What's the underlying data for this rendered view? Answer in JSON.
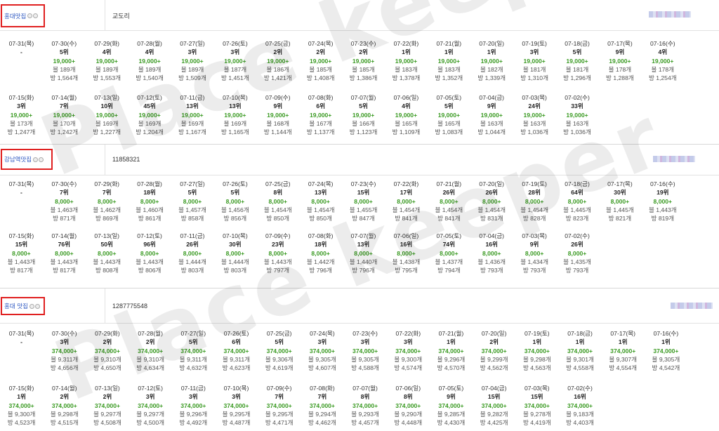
{
  "sections": [
    {
      "keyword": "홍대맛집",
      "code": "교도리",
      "row1": [
        {
          "d": "07-31(목)",
          "r": "-",
          "v": "",
          "a": "",
          "b": ""
        },
        {
          "d": "07-30(수)",
          "r": "5위",
          "v": "19,000+",
          "a": "블 189개",
          "b": "방 1,564개"
        },
        {
          "d": "07-29(화)",
          "r": "4위",
          "v": "19,000+",
          "a": "블 189개",
          "b": "방 1,553개"
        },
        {
          "d": "07-28(월)",
          "r": "4위",
          "v": "19,000+",
          "a": "블 189개",
          "b": "방 1,540개"
        },
        {
          "d": "07-27(일)",
          "r": "3위",
          "v": "19,000+",
          "a": "블 189개",
          "b": "방 1,509개"
        },
        {
          "d": "07-26(토)",
          "r": "3위",
          "v": "19,000+",
          "a": "블 187개",
          "b": "방 1,451개"
        },
        {
          "d": "07-25(금)",
          "r": "2위",
          "v": "19,000+",
          "a": "블 186개",
          "b": "방 1,421개"
        },
        {
          "d": "07-24(목)",
          "r": "2위",
          "v": "19,000+",
          "a": "블 185개",
          "b": "방 1,408개"
        },
        {
          "d": "07-23(수)",
          "r": "2위",
          "v": "19,000+",
          "a": "블 185개",
          "b": "방 1,386개"
        },
        {
          "d": "07-22(화)",
          "r": "1위",
          "v": "19,000+",
          "a": "블 183개",
          "b": "방 1,378개"
        },
        {
          "d": "07-21(월)",
          "r": "1위",
          "v": "19,000+",
          "a": "블 183개",
          "b": "방 1,352개"
        },
        {
          "d": "07-20(일)",
          "r": "1위",
          "v": "19,000+",
          "a": "블 182개",
          "b": "방 1,339개"
        },
        {
          "d": "07-19(토)",
          "r": "3위",
          "v": "19,000+",
          "a": "블 181개",
          "b": "방 1,310개"
        },
        {
          "d": "07-18(금)",
          "r": "5위",
          "v": "19,000+",
          "a": "블 181개",
          "b": "방 1,296개"
        },
        {
          "d": "07-17(목)",
          "r": "9위",
          "v": "19,000+",
          "a": "블 178개",
          "b": "방 1,288개"
        },
        {
          "d": "07-16(수)",
          "r": "4위",
          "v": "19,000+",
          "a": "블 178개",
          "b": "방 1,254개"
        }
      ],
      "row2": [
        {
          "d": "07-15(화)",
          "r": "3위",
          "v": "19,000+",
          "a": "블 173개",
          "b": "방 1,247개"
        },
        {
          "d": "07-14(월)",
          "r": "7위",
          "v": "19,000+",
          "a": "블 170개",
          "b": "방 1,242개"
        },
        {
          "d": "07-13(일)",
          "r": "10위",
          "v": "19,000+",
          "a": "블 169개",
          "b": "방 1,227개"
        },
        {
          "d": "07-12(토)",
          "r": "45위",
          "v": "19,000+",
          "a": "블 169개",
          "b": "방 1,204개"
        },
        {
          "d": "07-11(금)",
          "r": "13위",
          "v": "19,000+",
          "a": "블 169개",
          "b": "방 1,167개"
        },
        {
          "d": "07-10(목)",
          "r": "13위",
          "v": "19,000+",
          "a": "블 169개",
          "b": "방 1,165개"
        },
        {
          "d": "07-09(수)",
          "r": "9위",
          "v": "19,000+",
          "a": "블 168개",
          "b": "방 1,144개"
        },
        {
          "d": "07-08(화)",
          "r": "6위",
          "v": "19,000+",
          "a": "블 167개",
          "b": "방 1,137개"
        },
        {
          "d": "07-07(월)",
          "r": "5위",
          "v": "19,000+",
          "a": "블 166개",
          "b": "방 1,123개"
        },
        {
          "d": "07-06(일)",
          "r": "4위",
          "v": "19,000+",
          "a": "블 165개",
          "b": "방 1,109개"
        },
        {
          "d": "07-05(토)",
          "r": "5위",
          "v": "19,000+",
          "a": "블 165개",
          "b": "방 1,083개"
        },
        {
          "d": "07-04(금)",
          "r": "9위",
          "v": "19,000+",
          "a": "블 163개",
          "b": "방 1,044개"
        },
        {
          "d": "07-03(목)",
          "r": "24위",
          "v": "19,000+",
          "a": "블 163개",
          "b": "방 1,036개"
        },
        {
          "d": "07-02(수)",
          "r": "33위",
          "v": "19,000+",
          "a": "블 163개",
          "b": "방 1,036개"
        }
      ]
    },
    {
      "keyword": "강남역맛집",
      "code": "11858321",
      "row1": [
        {
          "d": "07-31(목)",
          "r": "-",
          "v": "",
          "a": "",
          "b": ""
        },
        {
          "d": "07-30(수)",
          "r": "7위",
          "v": "8,000+",
          "a": "블 1,463개",
          "b": "방 871개"
        },
        {
          "d": "07-29(화)",
          "r": "7위",
          "v": "8,000+",
          "a": "블 1,462개",
          "b": "방 869개"
        },
        {
          "d": "07-28(월)",
          "r": "18위",
          "v": "8,000+",
          "a": "블 1,460개",
          "b": "방 861개"
        },
        {
          "d": "07-27(일)",
          "r": "5위",
          "v": "8,000+",
          "a": "블 1,457개",
          "b": "방 858개"
        },
        {
          "d": "07-26(토)",
          "r": "5위",
          "v": "8,000+",
          "a": "블 1,456개",
          "b": "방 856개"
        },
        {
          "d": "07-25(금)",
          "r": "8위",
          "v": "8,000+",
          "a": "블 1,454개",
          "b": "방 850개"
        },
        {
          "d": "07-24(목)",
          "r": "13위",
          "v": "8,000+",
          "a": "블 1,454개",
          "b": "방 850개"
        },
        {
          "d": "07-23(수)",
          "r": "15위",
          "v": "8,000+",
          "a": "블 1,455개",
          "b": "방 847개"
        },
        {
          "d": "07-22(화)",
          "r": "17위",
          "v": "8,000+",
          "a": "블 1,454개",
          "b": "방 841개"
        },
        {
          "d": "07-21(월)",
          "r": "26위",
          "v": "8,000+",
          "a": "블 1,454개",
          "b": "방 841개"
        },
        {
          "d": "07-20(일)",
          "r": "26위",
          "v": "8,000+",
          "a": "블 1,454개",
          "b": "방 831개"
        },
        {
          "d": "07-19(토)",
          "r": "28위",
          "v": "8,000+",
          "a": "블 1,454개",
          "b": "방 828개"
        },
        {
          "d": "07-18(금)",
          "r": "64위",
          "v": "8,000+",
          "a": "블 1,445개",
          "b": "방 823개"
        },
        {
          "d": "07-17(목)",
          "r": "30위",
          "v": "8,000+",
          "a": "블 1,445개",
          "b": "방 821개"
        },
        {
          "d": "07-16(수)",
          "r": "19위",
          "v": "8,000+",
          "a": "블 1,443개",
          "b": "방 819개"
        }
      ],
      "row2": [
        {
          "d": "07-15(화)",
          "r": "15위",
          "v": "8,000+",
          "a": "블 1,443개",
          "b": "방 817개"
        },
        {
          "d": "07-14(월)",
          "r": "76위",
          "v": "8,000+",
          "a": "블 1,443개",
          "b": "방 817개"
        },
        {
          "d": "07-13(일)",
          "r": "50위",
          "v": "8,000+",
          "a": "블 1,443개",
          "b": "방 808개"
        },
        {
          "d": "07-12(토)",
          "r": "96위",
          "v": "8,000+",
          "a": "블 1,443개",
          "b": "방 806개"
        },
        {
          "d": "07-11(금)",
          "r": "26위",
          "v": "8,000+",
          "a": "블 1,444개",
          "b": "방 803개"
        },
        {
          "d": "07-10(목)",
          "r": "30위",
          "v": "8,000+",
          "a": "블 1,444개",
          "b": "방 803개"
        },
        {
          "d": "07-09(수)",
          "r": "23위",
          "v": "8,000+",
          "a": "블 1,443개",
          "b": "방 797개"
        },
        {
          "d": "07-08(화)",
          "r": "18위",
          "v": "8,000+",
          "a": "블 1,442개",
          "b": "방 796개"
        },
        {
          "d": "07-07(월)",
          "r": "13위",
          "v": "8,000+",
          "a": "블 1,440개",
          "b": "방 796개"
        },
        {
          "d": "07-06(일)",
          "r": "16위",
          "v": "8,000+",
          "a": "블 1,438개",
          "b": "방 795개"
        },
        {
          "d": "07-05(토)",
          "r": "74위",
          "v": "8,000+",
          "a": "블 1,437개",
          "b": "방 794개"
        },
        {
          "d": "07-04(금)",
          "r": "16위",
          "v": "8,000+",
          "a": "블 1,436개",
          "b": "방 793개"
        },
        {
          "d": "07-03(목)",
          "r": "9위",
          "v": "8,000+",
          "a": "블 1,434개",
          "b": "방 793개"
        },
        {
          "d": "07-02(수)",
          "r": "26위",
          "v": "8,000+",
          "a": "블 1,435개",
          "b": "방 793개"
        }
      ]
    },
    {
      "keyword": "홍대 맛집",
      "code": "1287775548",
      "row1": [
        {
          "d": "07-31(목)",
          "r": "-",
          "v": "",
          "a": "",
          "b": ""
        },
        {
          "d": "07-30(수)",
          "r": "3위",
          "v": "374,000+",
          "a": "블 9,311개",
          "b": "방 4,656개"
        },
        {
          "d": "07-29(화)",
          "r": "2위",
          "v": "374,000+",
          "a": "블 9,310개",
          "b": "방 4,650개"
        },
        {
          "d": "07-28(월)",
          "r": "2위",
          "v": "374,000+",
          "a": "블 9,310개",
          "b": "방 4,634개"
        },
        {
          "d": "07-27(일)",
          "r": "5위",
          "v": "374,000+",
          "a": "블 9,311개",
          "b": "방 4,632개"
        },
        {
          "d": "07-26(토)",
          "r": "6위",
          "v": "374,000+",
          "a": "블 9,311개",
          "b": "방 4,623개"
        },
        {
          "d": "07-25(금)",
          "r": "5위",
          "v": "374,000+",
          "a": "블 9,306개",
          "b": "방 4,619개"
        },
        {
          "d": "07-24(목)",
          "r": "3위",
          "v": "374,000+",
          "a": "블 9,305개",
          "b": "방 4,607개"
        },
        {
          "d": "07-23(수)",
          "r": "3위",
          "v": "374,000+",
          "a": "블 9,305개",
          "b": "방 4,588개"
        },
        {
          "d": "07-22(화)",
          "r": "3위",
          "v": "374,000+",
          "a": "블 9,300개",
          "b": "방 4,574개"
        },
        {
          "d": "07-21(월)",
          "r": "1위",
          "v": "374,000+",
          "a": "블 9,296개",
          "b": "방 4,570개"
        },
        {
          "d": "07-20(일)",
          "r": "2위",
          "v": "374,000+",
          "a": "블 9,299개",
          "b": "방 4,562개"
        },
        {
          "d": "07-19(토)",
          "r": "1위",
          "v": "374,000+",
          "a": "블 9,298개",
          "b": "방 4,563개"
        },
        {
          "d": "07-18(금)",
          "r": "1위",
          "v": "374,000+",
          "a": "블 9,301개",
          "b": "방 4,558개"
        },
        {
          "d": "07-17(목)",
          "r": "1위",
          "v": "374,000+",
          "a": "블 9,307개",
          "b": "방 4,554개"
        },
        {
          "d": "07-16(수)",
          "r": "1위",
          "v": "374,000+",
          "a": "블 9,305개",
          "b": "방 4,542개"
        }
      ],
      "row2": [
        {
          "d": "07-15(화)",
          "r": "1위",
          "v": "374,000+",
          "a": "블 9,300개",
          "b": "방 4,523개"
        },
        {
          "d": "07-14(월)",
          "r": "2위",
          "v": "374,000+",
          "a": "블 9,298개",
          "b": "방 4,515개"
        },
        {
          "d": "07-13(일)",
          "r": "2위",
          "v": "374,000+",
          "a": "블 9,297개",
          "b": "방 4,508개"
        },
        {
          "d": "07-12(토)",
          "r": "3위",
          "v": "374,000+",
          "a": "블 9,297개",
          "b": "방 4,500개"
        },
        {
          "d": "07-11(금)",
          "r": "3위",
          "v": "374,000+",
          "a": "블 9,296개",
          "b": "방 4,492개"
        },
        {
          "d": "07-10(목)",
          "r": "3위",
          "v": "374,000+",
          "a": "블 9,295개",
          "b": "방 4,487개"
        },
        {
          "d": "07-09(수)",
          "r": "7위",
          "v": "374,000+",
          "a": "블 9,295개",
          "b": "방 4,471개"
        },
        {
          "d": "07-08(화)",
          "r": "7위",
          "v": "374,000+",
          "a": "블 9,294개",
          "b": "방 4,462개"
        },
        {
          "d": "07-07(월)",
          "r": "8위",
          "v": "374,000+",
          "a": "블 9,293개",
          "b": "방 4,457개"
        },
        {
          "d": "07-06(일)",
          "r": "8위",
          "v": "374,000+",
          "a": "블 9,290개",
          "b": "방 4,448개"
        },
        {
          "d": "07-05(토)",
          "r": "9위",
          "v": "374,000+",
          "a": "블 9,285개",
          "b": "방 4,430개"
        },
        {
          "d": "07-04(금)",
          "r": "15위",
          "v": "374,000+",
          "a": "블 9,282개",
          "b": "방 4,425개"
        },
        {
          "d": "07-03(목)",
          "r": "15위",
          "v": "374,000+",
          "a": "블 9,278개",
          "b": "방 4,419개"
        },
        {
          "d": "07-02(수)",
          "r": "16위",
          "v": "374,000+",
          "a": "블 9,183개",
          "b": "방 4,403개"
        }
      ]
    }
  ],
  "watermark": "Place keeper",
  "colors": {
    "highlight_border": "#e02020",
    "keyword_link": "#2a55c0",
    "value_green": "#3a9a22"
  }
}
